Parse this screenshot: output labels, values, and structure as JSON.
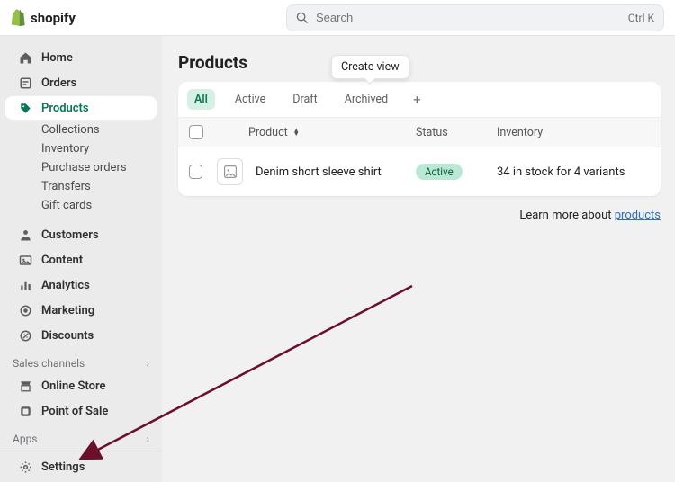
{
  "brand": "shopify",
  "search": {
    "placeholder": "Search",
    "shortcut": "Ctrl K"
  },
  "nav": {
    "home": "Home",
    "orders": "Orders",
    "products": "Products",
    "products_sub": {
      "collections": "Collections",
      "inventory": "Inventory",
      "purchase_orders": "Purchase orders",
      "transfers": "Transfers",
      "gift_cards": "Gift cards"
    },
    "customers": "Customers",
    "content": "Content",
    "analytics": "Analytics",
    "marketing": "Marketing",
    "discounts": "Discounts",
    "sales_channels_header": "Sales channels",
    "online_store": "Online Store",
    "pos": "Point of Sale",
    "apps_header": "Apps",
    "settings": "Settings"
  },
  "page": {
    "title": "Products",
    "tooltip": "Create view",
    "tabs": {
      "all": "All",
      "active": "Active",
      "draft": "Draft",
      "archived": "Archived"
    },
    "columns": {
      "product": "Product",
      "status": "Status",
      "inventory": "Inventory"
    },
    "row": {
      "name": "Denim short sleeve shirt",
      "status": "Active",
      "inventory": "34 in stock for 4 variants"
    },
    "learn_prefix": "Learn more about ",
    "learn_link": "products"
  }
}
